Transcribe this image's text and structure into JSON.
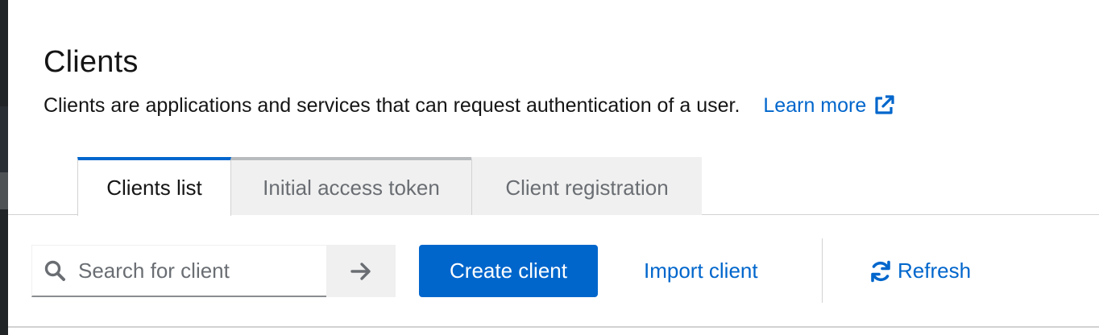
{
  "header": {
    "title": "Clients",
    "description": "Clients are applications and services that can request authentication of a user.",
    "learn_more": "Learn more"
  },
  "tabs": [
    {
      "label": "Clients list",
      "active": true
    },
    {
      "label": "Initial access token",
      "active": false
    },
    {
      "label": "Client registration",
      "active": false
    }
  ],
  "toolbar": {
    "search_placeholder": "Search for client",
    "create_label": "Create client",
    "import_label": "Import client",
    "refresh_label": "Refresh"
  },
  "icons": {
    "learn_more": "external-link-icon",
    "search": "search-icon",
    "search_go": "arrow-right-icon",
    "refresh": "refresh-icon"
  },
  "colors": {
    "accent": "#0066cc",
    "text": "#151515",
    "muted": "#6a6e73",
    "tab_inactive_bg": "#f0f0f0"
  }
}
